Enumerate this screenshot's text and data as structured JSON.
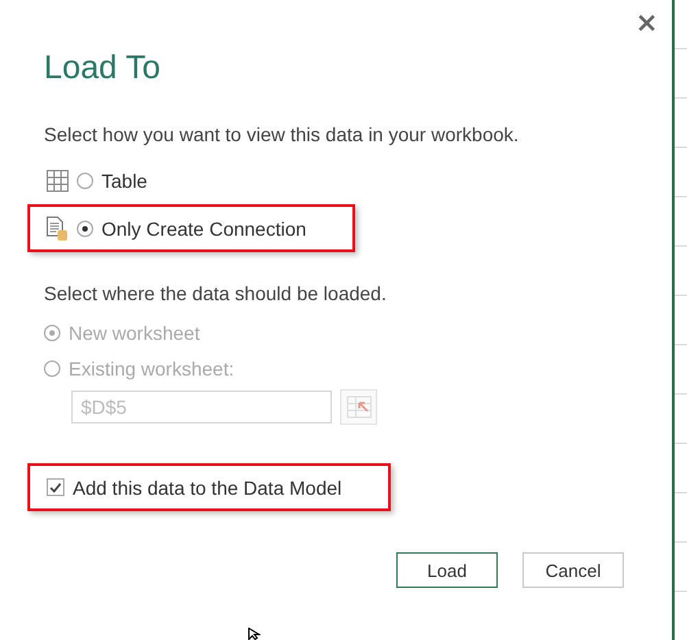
{
  "dialog": {
    "title": "Load To",
    "close": "×"
  },
  "view": {
    "prompt": "Select how you want to view this data in your workbook.",
    "options": [
      {
        "kind": "table",
        "label": "Table",
        "selected": false,
        "highlighted": false
      },
      {
        "kind": "connection",
        "label": "Only Create Connection",
        "selected": true,
        "highlighted": true
      }
    ]
  },
  "location": {
    "prompt": "Select where the data should be loaded.",
    "disabled": true,
    "options": [
      {
        "label": "New worksheet",
        "selected": true
      },
      {
        "label": "Existing worksheet:",
        "selected": false
      }
    ],
    "cell": {
      "value": "$D$5"
    }
  },
  "data_model": {
    "label": "Add this data to the Data Model",
    "checked": true,
    "highlighted": true
  },
  "buttons": [
    {
      "label": "Load",
      "default": true
    },
    {
      "label": "Cancel",
      "default": false
    }
  ]
}
